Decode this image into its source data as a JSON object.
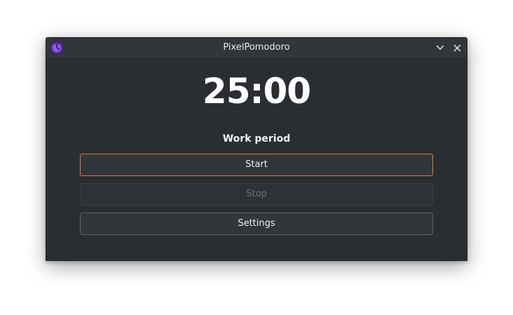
{
  "window": {
    "title": "PixelPomodoro",
    "app_icon": "pomodoro-app-icon",
    "controls": {
      "minimize_icon": "chevron-down-icon",
      "close_icon": "close-icon"
    }
  },
  "timer": {
    "display": "25:00",
    "period_label": "Work period"
  },
  "buttons": {
    "start_label": "Start",
    "stop_label": "Stop",
    "settings_label": "Settings"
  },
  "colors": {
    "window_bg": "#2a2e32",
    "titlebar_bg": "#31363b",
    "focus_accent": "#d97c3e",
    "disabled_text": "#6d7176"
  }
}
